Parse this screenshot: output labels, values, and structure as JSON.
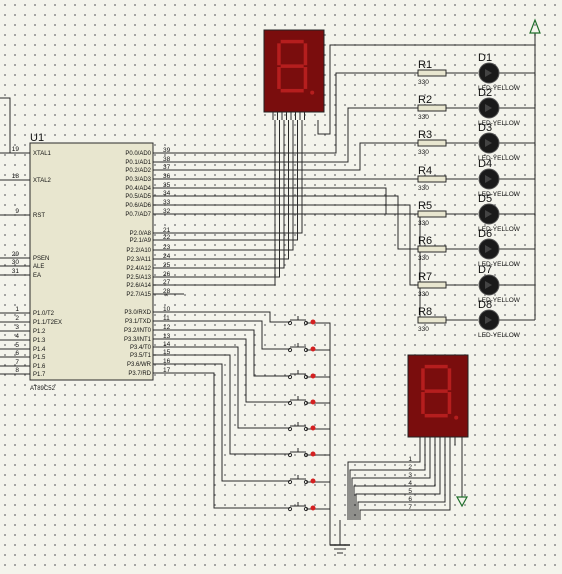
{
  "mcu": {
    "ref": "U1",
    "part": "AT89C52",
    "left_pins": [
      {
        "num": "19",
        "name": "XTAL1"
      },
      {
        "num": "18",
        "name": "XTAL2"
      },
      {
        "num": "9",
        "name": "RST"
      },
      {
        "num": "29",
        "name": "PSEN"
      },
      {
        "num": "30",
        "name": "ALE"
      },
      {
        "num": "31",
        "name": "EA"
      },
      {
        "num": "1",
        "name": "P1.0/T2"
      },
      {
        "num": "2",
        "name": "P1.1/T2EX"
      },
      {
        "num": "3",
        "name": "P1.2"
      },
      {
        "num": "4",
        "name": "P1.3"
      },
      {
        "num": "5",
        "name": "P1.4"
      },
      {
        "num": "6",
        "name": "P1.5"
      },
      {
        "num": "7",
        "name": "P1.6"
      },
      {
        "num": "8",
        "name": "P1.7"
      }
    ],
    "right_pins": [
      {
        "num": "39",
        "name": "P0.0/AD0"
      },
      {
        "num": "38",
        "name": "P0.1/AD1"
      },
      {
        "num": "37",
        "name": "P0.2/AD2"
      },
      {
        "num": "36",
        "name": "P0.3/AD3"
      },
      {
        "num": "35",
        "name": "P0.4/AD4"
      },
      {
        "num": "34",
        "name": "P0.5/AD5"
      },
      {
        "num": "33",
        "name": "P0.6/AD6"
      },
      {
        "num": "32",
        "name": "P0.7/AD7"
      },
      {
        "num": "21",
        "name": "P2.0/A8"
      },
      {
        "num": "22",
        "name": "P2.1/A9"
      },
      {
        "num": "23",
        "name": "P2.2/A10"
      },
      {
        "num": "24",
        "name": "P2.3/A11"
      },
      {
        "num": "25",
        "name": "P2.4/A12"
      },
      {
        "num": "26",
        "name": "P2.5/A13"
      },
      {
        "num": "27",
        "name": "P2.6/A14"
      },
      {
        "num": "28",
        "name": "P2.7/A15"
      },
      {
        "num": "10",
        "name": "P3.0/RXD"
      },
      {
        "num": "11",
        "name": "P3.1/TXD"
      },
      {
        "num": "12",
        "name": "P3.2/INT0"
      },
      {
        "num": "13",
        "name": "P3.3/INT1"
      },
      {
        "num": "14",
        "name": "P3.4/T0"
      },
      {
        "num": "15",
        "name": "P3.5/T1"
      },
      {
        "num": "16",
        "name": "P3.6/WR"
      },
      {
        "num": "17",
        "name": "P3.7/RD"
      }
    ]
  },
  "resistors": [
    {
      "ref": "R1",
      "value": "330"
    },
    {
      "ref": "R2",
      "value": "330"
    },
    {
      "ref": "R3",
      "value": "330"
    },
    {
      "ref": "R4",
      "value": "330"
    },
    {
      "ref": "R5",
      "value": "330"
    },
    {
      "ref": "R6",
      "value": "330"
    },
    {
      "ref": "R7",
      "value": "330"
    },
    {
      "ref": "R8",
      "value": "330"
    }
  ],
  "leds": [
    {
      "ref": "D1",
      "value": "LED-YELLOW"
    },
    {
      "ref": "D2",
      "value": "LED-YELLOW"
    },
    {
      "ref": "D3",
      "value": "LED-YELLOW"
    },
    {
      "ref": "D4",
      "value": "LED-YELLOW"
    },
    {
      "ref": "D5",
      "value": "LED-YELLOW"
    },
    {
      "ref": "D6",
      "value": "LED-YELLOW"
    },
    {
      "ref": "D7",
      "value": "LED-YELLOW"
    },
    {
      "ref": "D8",
      "value": "LED-YELLOW"
    }
  ],
  "display_top": {
    "digit": "8"
  },
  "display_bottom": {
    "digit": "8",
    "pins": [
      "1",
      "2",
      "3",
      "4",
      "5",
      "6",
      "7"
    ]
  },
  "colors": {
    "wire": "#2a2a2a",
    "chip_fill": "#e8e6cf",
    "display_body": "#7a0d0d",
    "segment": "#b51e1e",
    "led": "#1a1a1a",
    "switch_dot": "#d42020",
    "resistor_fill": "#e8e6cf",
    "power": "#1e6e2a"
  }
}
